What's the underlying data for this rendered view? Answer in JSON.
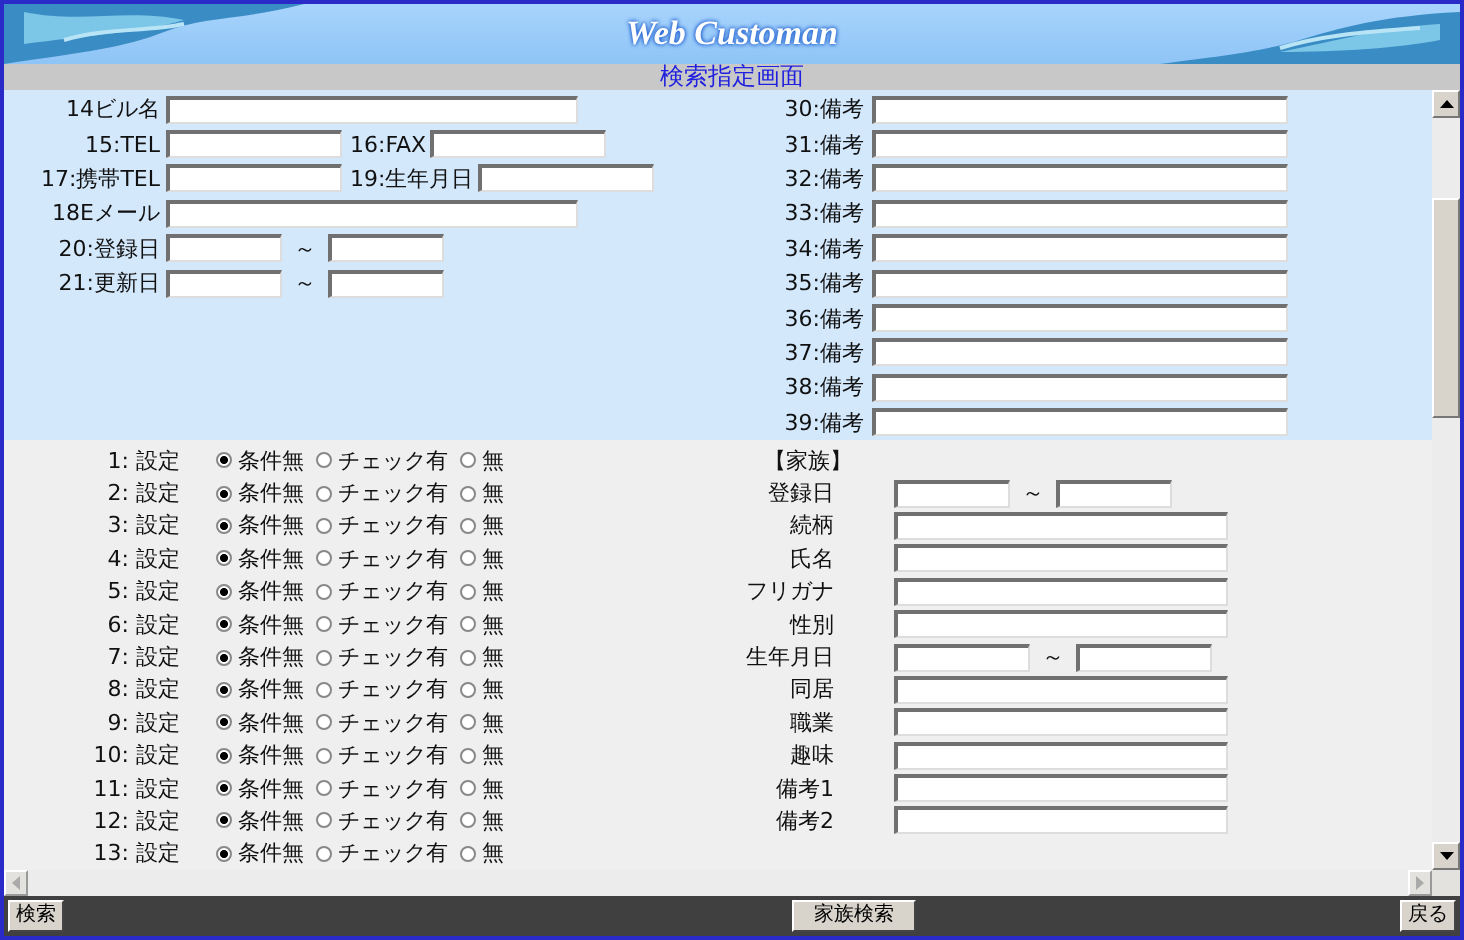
{
  "header": {
    "title": "Web Customan",
    "subtitle": "検索指定画面"
  },
  "upper_left": [
    {
      "kind": "wide",
      "label": "14ビル名"
    },
    {
      "kind": "pair",
      "label": "15:TEL",
      "label2": "16:FAX"
    },
    {
      "kind": "pair",
      "label": "17:携帯TEL",
      "label2": "19:生年月日"
    },
    {
      "kind": "wide",
      "label": "18Eメール"
    },
    {
      "kind": "range",
      "label": "20:登録日",
      "separator": "～"
    },
    {
      "kind": "range",
      "label": "21:更新日",
      "separator": "～"
    }
  ],
  "upper_right": [
    "30:備考",
    "31:備考",
    "32:備考",
    "33:備考",
    "34:備考",
    "35:備考",
    "36:備考",
    "37:備考",
    "38:備考",
    "39:備考"
  ],
  "settings": [
    {
      "label": "1: 設定",
      "options": [
        {
          "label": "条件無",
          "selected": true
        },
        {
          "label": "チェック有",
          "selected": false
        },
        {
          "label": "無",
          "selected": false
        }
      ]
    },
    {
      "label": "2: 設定",
      "options": [
        {
          "label": "条件無",
          "selected": true
        },
        {
          "label": "チェック有",
          "selected": false
        },
        {
          "label": "無",
          "selected": false
        }
      ]
    },
    {
      "label": "3: 設定",
      "options": [
        {
          "label": "条件無",
          "selected": true
        },
        {
          "label": "チェック有",
          "selected": false
        },
        {
          "label": "無",
          "selected": false
        }
      ]
    },
    {
      "label": "4: 設定",
      "options": [
        {
          "label": "条件無",
          "selected": true
        },
        {
          "label": "チェック有",
          "selected": false
        },
        {
          "label": "無",
          "selected": false
        }
      ]
    },
    {
      "label": "5: 設定",
      "options": [
        {
          "label": "条件無",
          "selected": true
        },
        {
          "label": "チェック有",
          "selected": false
        },
        {
          "label": "無",
          "selected": false
        }
      ]
    },
    {
      "label": "6: 設定",
      "options": [
        {
          "label": "条件無",
          "selected": true
        },
        {
          "label": "チェック有",
          "selected": false
        },
        {
          "label": "無",
          "selected": false
        }
      ]
    },
    {
      "label": "7: 設定",
      "options": [
        {
          "label": "条件無",
          "selected": true
        },
        {
          "label": "チェック有",
          "selected": false
        },
        {
          "label": "無",
          "selected": false
        }
      ]
    },
    {
      "label": "8: 設定",
      "options": [
        {
          "label": "条件無",
          "selected": true
        },
        {
          "label": "チェック有",
          "selected": false
        },
        {
          "label": "無",
          "selected": false
        }
      ]
    },
    {
      "label": "9: 設定",
      "options": [
        {
          "label": "条件無",
          "selected": true
        },
        {
          "label": "チェック有",
          "selected": false
        },
        {
          "label": "無",
          "selected": false
        }
      ]
    },
    {
      "label": "10: 設定",
      "options": [
        {
          "label": "条件無",
          "selected": true
        },
        {
          "label": "チェック有",
          "selected": false
        },
        {
          "label": "無",
          "selected": false
        }
      ]
    },
    {
      "label": "11: 設定",
      "options": [
        {
          "label": "条件無",
          "selected": true
        },
        {
          "label": "チェック有",
          "selected": false
        },
        {
          "label": "無",
          "selected": false
        }
      ]
    },
    {
      "label": "12: 設定",
      "options": [
        {
          "label": "条件無",
          "selected": true
        },
        {
          "label": "チェック有",
          "selected": false
        },
        {
          "label": "無",
          "selected": false
        }
      ]
    },
    {
      "label": "13: 設定",
      "options": [
        {
          "label": "条件無",
          "selected": true
        },
        {
          "label": "チェック有",
          "selected": false
        },
        {
          "label": "無",
          "selected": false
        }
      ]
    }
  ],
  "family": {
    "title": "【家族】",
    "fields": [
      {
        "kind": "range",
        "label": "登録日",
        "separator": "～"
      },
      {
        "kind": "text",
        "label": "続柄"
      },
      {
        "kind": "text",
        "label": "氏名"
      },
      {
        "kind": "text",
        "label": "フリガナ"
      },
      {
        "kind": "text",
        "label": "性別"
      },
      {
        "kind": "range",
        "label": "生年月日",
        "separator": "～"
      },
      {
        "kind": "text",
        "label": "同居"
      },
      {
        "kind": "text",
        "label": "職業"
      },
      {
        "kind": "text",
        "label": "趣味"
      },
      {
        "kind": "text",
        "label": "備考1"
      },
      {
        "kind": "text",
        "label": "備考2"
      }
    ]
  },
  "footer": {
    "buttons": [
      "検索",
      "家族検索",
      "戻る"
    ]
  }
}
